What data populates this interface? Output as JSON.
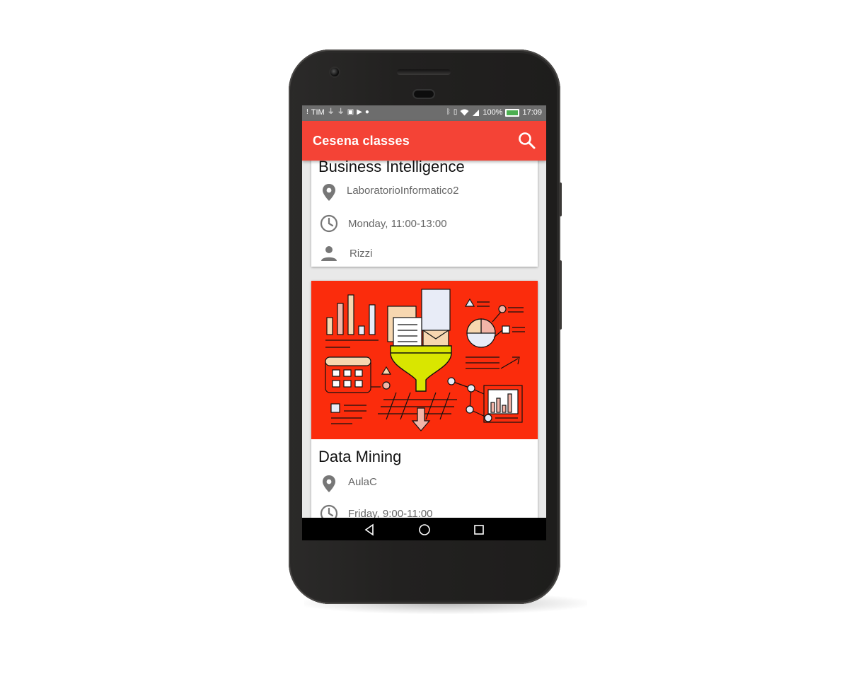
{
  "status_bar": {
    "carrier": "TIM",
    "battery": "100%",
    "time": "17:09"
  },
  "app_bar": {
    "title": "Cesena classes",
    "actions": [
      {
        "icon": "search-icon"
      }
    ]
  },
  "classes": [
    {
      "name": "Business Intelligence",
      "room": "LaboratorioInformatico2",
      "schedule": "Monday, 11:00-13:00",
      "teacher": "Rizzi"
    },
    {
      "name": "Data Mining",
      "room": "AulaC",
      "schedule": "Friday, 9:00-11:00",
      "image": "data-mining-illustration"
    }
  ],
  "nav_bar": {
    "buttons": [
      {
        "icon": "back-triangle-icon"
      },
      {
        "icon": "home-circle-icon"
      },
      {
        "icon": "recents-square-icon"
      }
    ]
  },
  "colors": {
    "primary": "#f44336",
    "illustration_bg": "#fb2c0c",
    "funnel": "#d9e600",
    "status_bar": "#6d6d6d",
    "phone_body": "#242322"
  }
}
